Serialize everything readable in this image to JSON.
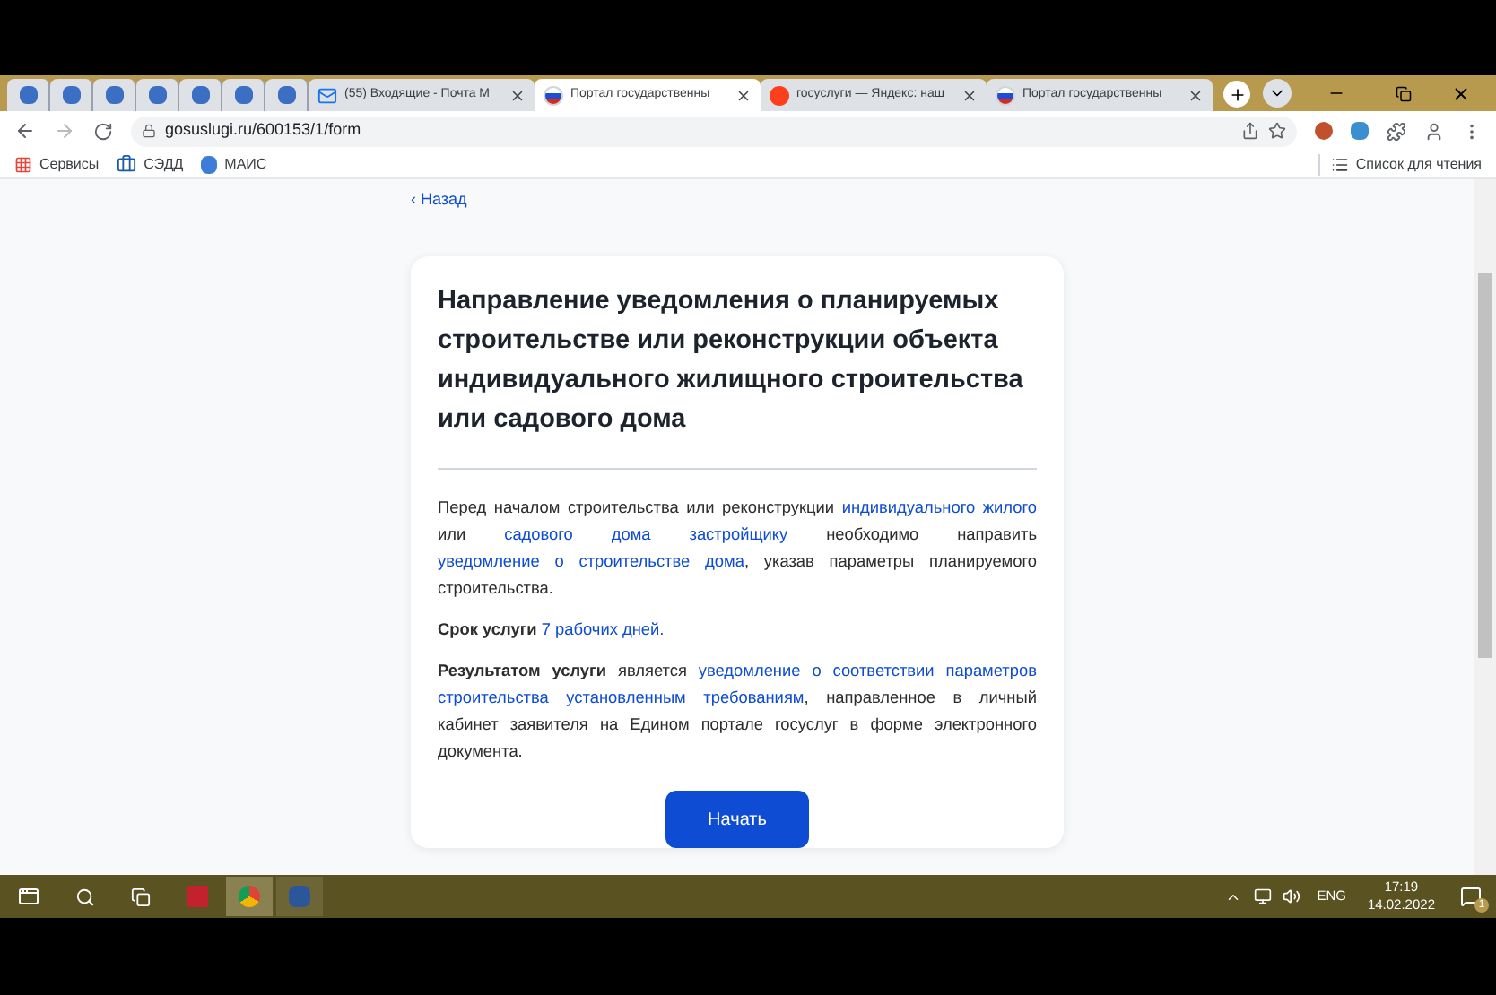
{
  "browser": {
    "pinned_tabs": [
      {
        "selected": false
      },
      {
        "selected": false
      },
      {
        "selected": false
      },
      {
        "selected": false
      },
      {
        "selected": false
      },
      {
        "selected": false
      },
      {
        "selected": false
      }
    ],
    "tabs": [
      {
        "title": "(55) Входящие - Почта М",
        "selected": false,
        "kind": "mail"
      },
      {
        "title": "Портал государственны",
        "selected": true,
        "kind": "flag"
      },
      {
        "title": "госуслуги — Яндекс: наш",
        "selected": false,
        "kind": "yandex"
      },
      {
        "title": "Портал государственны",
        "selected": false,
        "kind": "flag"
      }
    ],
    "url": "gosuslugi.ru/600153/1/form",
    "bookmarks": [
      {
        "label": "Сервисы",
        "kind": "apps"
      },
      {
        "label": "СЭДД",
        "kind": "case"
      },
      {
        "label": "МАИС",
        "kind": "logo"
      }
    ],
    "reading_list": "Список для чтения"
  },
  "page": {
    "back": "‹ Назад",
    "title": "Направление уведомления о планируемых строительстве или реконструкции объекта индивидуального жилищного строительства или садового дома",
    "paragraphs": [
      [
        {
          "kind": "text",
          "text": "Перед началом строительства или реконструкции "
        },
        {
          "kind": "link",
          "text": "индивидуального"
        },
        {
          "kind": "link",
          "text": "жилого"
        },
        {
          "kind": "text",
          "text": " или "
        },
        {
          "kind": "link",
          "text": "садового дома застройщику"
        },
        {
          "kind": "text",
          "text": " необходимо направить "
        },
        {
          "kind": "link",
          "text": "уведомление о строительстве дома"
        },
        {
          "kind": "text",
          "text": ", указав параметры планируемого строительства."
        }
      ],
      [
        {
          "kind": "bold",
          "text": "Срок услуги "
        },
        {
          "kind": "link",
          "text": "7 рабочих дней."
        }
      ],
      [
        {
          "kind": "bold",
          "text": "Результатом услуги"
        },
        {
          "kind": "text",
          "text": " является "
        },
        {
          "kind": "link",
          "text": "уведомление о соответствии параметров"
        },
        {
          "kind": "link",
          "text": "строительства установленным требованиям"
        },
        {
          "kind": "text",
          "text": ", направленное в личный кабинет заявителя на Едином портале госуслуг в форме электронного документа."
        }
      ]
    ],
    "button": "Начать"
  },
  "taskbar": {
    "lang": "ENG",
    "time": "17:19",
    "date": "14.02.2022",
    "notifications": "1"
  }
}
